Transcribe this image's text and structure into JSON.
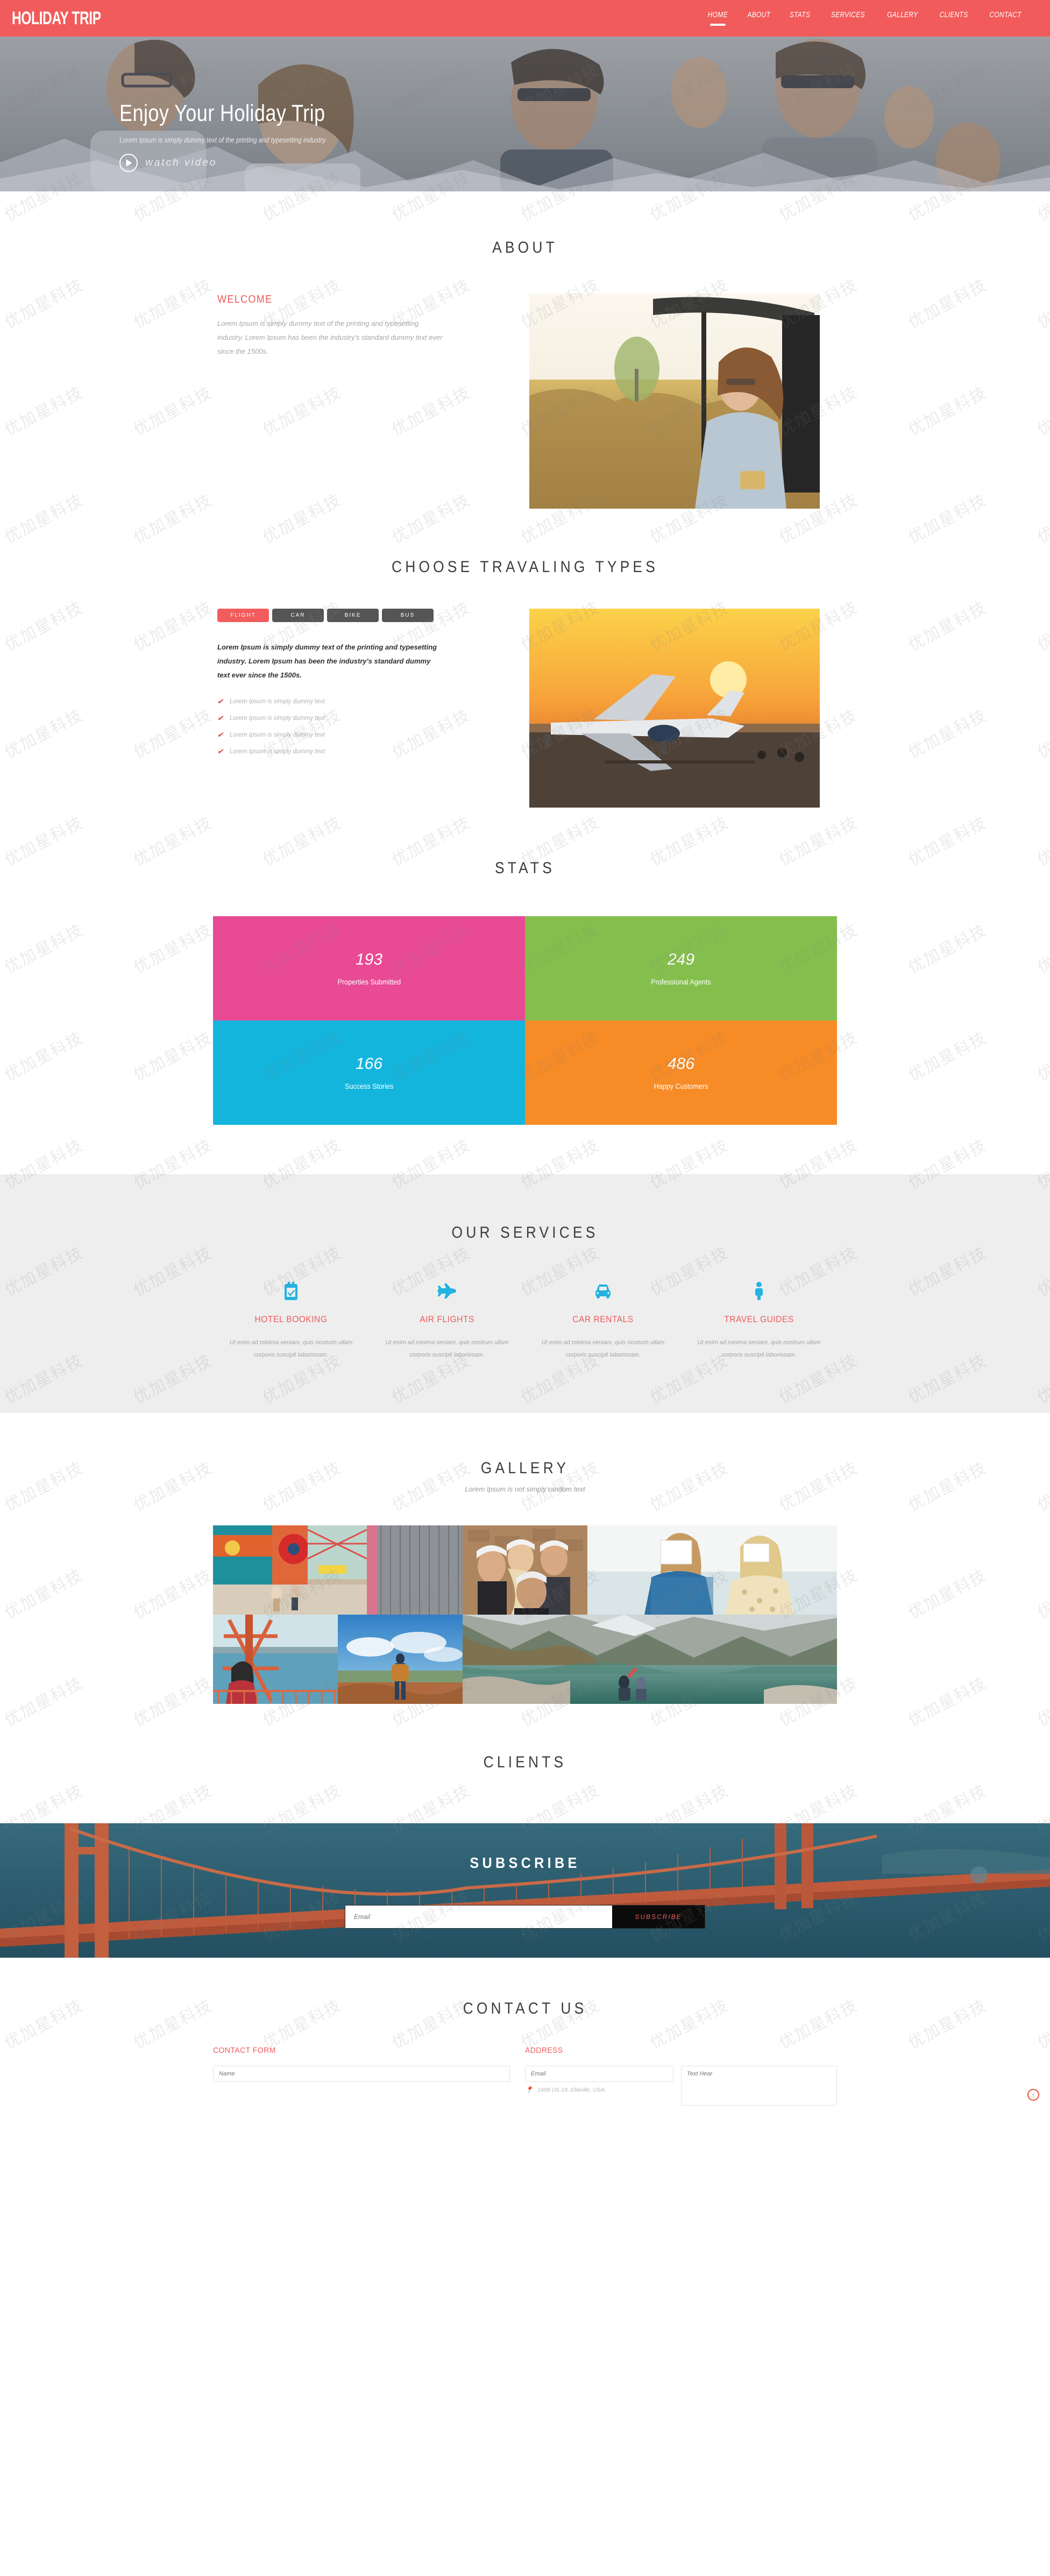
{
  "watermark": {
    "text": "优加星科技"
  },
  "header": {
    "logo": "HOLIDAY TRIP",
    "nav": [
      {
        "label": "HOME",
        "active": true
      },
      {
        "label": "ABOUT",
        "active": false
      },
      {
        "label": "STATS",
        "active": false
      },
      {
        "label": "SERVICES",
        "active": false
      },
      {
        "label": "GALLERY",
        "active": false
      },
      {
        "label": "CLIENTS",
        "active": false
      },
      {
        "label": "CONTACT",
        "active": false
      }
    ]
  },
  "hero": {
    "title": "Enjoy Your Holiday Trip",
    "subtitle": "Lorem Ipsum is simply dummy text of the printing and typesetting industry.",
    "watch_label": "watch video",
    "play_icon": "play-icon"
  },
  "about": {
    "title": "ABOUT",
    "welcome_heading": "WELCOME",
    "paragraph": "Lorem Ipsum is simply dummy text of the printing and typesetting industry. Lorem Ipsum has been the industry's standard dummy text ever since the 1500s.",
    "image_alt": "woman-in-tuktuk-photo"
  },
  "travel_types": {
    "title": "CHOOSE TRAVALING TYPES",
    "tabs": [
      {
        "label": "FLIGHT",
        "active": true
      },
      {
        "label": "CAR",
        "active": false
      },
      {
        "label": "BIKE",
        "active": false
      },
      {
        "label": "BUS",
        "active": false
      }
    ],
    "paragraph": "Lorem Ipsum is simply dummy text of the printing and typesetting industry. Lorem Ipsum has been the industry's standard dummy text ever since the 1500s.",
    "list": [
      "Lorem Ipsum is simply dummy text",
      "Lorem Ipsum is simply dummy text",
      "Lorem Ipsum is simply dummy text",
      "Lorem Ipsum is simply dummy text"
    ],
    "image_alt": "airplane-sunset-photo"
  },
  "stats": {
    "title": "STATS",
    "items": [
      {
        "value": "193",
        "label": "Properties Submitted",
        "color": "#e84a94"
      },
      {
        "value": "249",
        "label": "Professional Agents",
        "color": "#84bf4d"
      },
      {
        "value": "166",
        "label": "Success Stories",
        "color": "#14b5dd"
      },
      {
        "value": "486",
        "label": "Happy Customers",
        "color": "#f78b26"
      }
    ]
  },
  "services": {
    "title": "OUR SERVICES",
    "accent": "#22b3e0",
    "items": [
      {
        "icon": "clipboard-check-icon",
        "title": "HOTEL BOOKING",
        "text": "Ut enim ad minima veniam, quis nostrum ullam corporis suscipit laboriosam."
      },
      {
        "icon": "airplane-icon",
        "title": "AIR FLIGHTS",
        "text": "Ut enim ad minima veniam, quis nostrum ullam corporis suscipit laboriosam."
      },
      {
        "icon": "car-icon",
        "title": "CAR RENTALS",
        "text": "Ut enim ad minima veniam, quis nostrum ullam corporis suscipit laboriosam."
      },
      {
        "icon": "person-icon",
        "title": "TRAVEL GUIDES",
        "text": "Ut enim ad minima veniam, quis nostrum ullam corporis suscipit laboriosam."
      }
    ]
  },
  "gallery": {
    "title": "GALLERY",
    "subtitle": "Lorem Ipsum is not simply random text",
    "images": [
      {
        "alt": "boardwalk-amusement-street-photo"
      },
      {
        "alt": "friends-in-caps-photo"
      },
      {
        "alt": "two-women-beach-photo"
      },
      {
        "alt": "woman-ferris-wheel-photo"
      },
      {
        "alt": "hiker-backpack-cliff-photo"
      },
      {
        "alt": "mountain-lake-photo"
      }
    ]
  },
  "clients": {
    "title": "CLIENTS"
  },
  "subscribe": {
    "title": "SUBSCRIBE",
    "placeholder": "Email",
    "button": "SUBSCRIBE",
    "background_alt": "golden-gate-bridge-photo"
  },
  "contact": {
    "title": "CONTACT US",
    "form_heading": "CONTACT FORM",
    "address_heading": "ADDRESS",
    "name_placeholder": "Name",
    "email_placeholder": "Email",
    "text_placeholder": "Text Hear",
    "address_line": "1608 US-19, Ellaville, USA.",
    "pin_icon": "map-pin-icon"
  },
  "scroll_top": {
    "icon": "arrow-up-icon",
    "color": "#e1523e"
  }
}
